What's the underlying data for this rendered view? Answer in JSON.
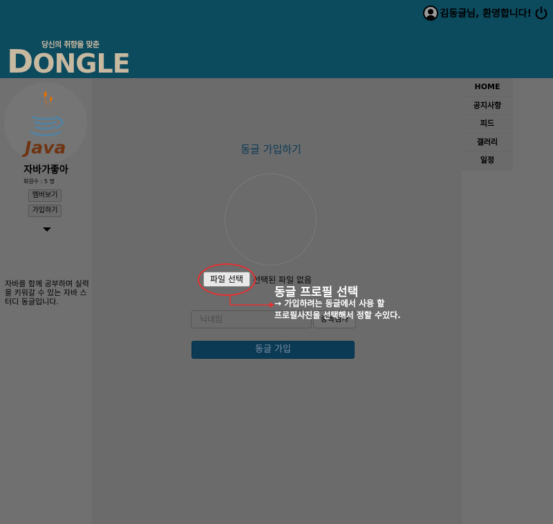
{
  "header": {
    "welcome_text": "김동글님, 환영합니다!",
    "logo_tagline": "당신의 취향을 맞춘",
    "logo_first": "D",
    "logo_rest": "ONGLE",
    "colors": {
      "header_bg": "#0c4a5e",
      "logo": "#c7b8a0"
    },
    "icons": [
      "user-icon",
      "power-icon"
    ]
  },
  "sidebar": {
    "java_label": "Java",
    "club_name": "자바가좋아",
    "member_count": "회원수 : 5 명",
    "members_button": "멤버보기",
    "join_button": "가입하기",
    "description": "자바를 함께 공부하며 실력을 키워갈 수 있는 자바 스터디 동글입니다."
  },
  "main": {
    "page_title": "동글 가입하기",
    "file_button": "파일 선택",
    "file_status": "선택된 파일 없음",
    "nickname_placeholder": "닉네임",
    "dup_check_button": "중복검사",
    "submit_button": "동글 가입",
    "accent_color": "#0b3a55"
  },
  "nav": {
    "items": [
      "HOME",
      "공지사항",
      "피드",
      "갤러리",
      "일정"
    ]
  },
  "annotation": {
    "title": "동글 프로필 선택",
    "line1": "→ 가입하려는 동글에서 사용 할",
    "line2": "프로필사진을 선택해서 정할 수있다.",
    "color": "#e53030"
  }
}
